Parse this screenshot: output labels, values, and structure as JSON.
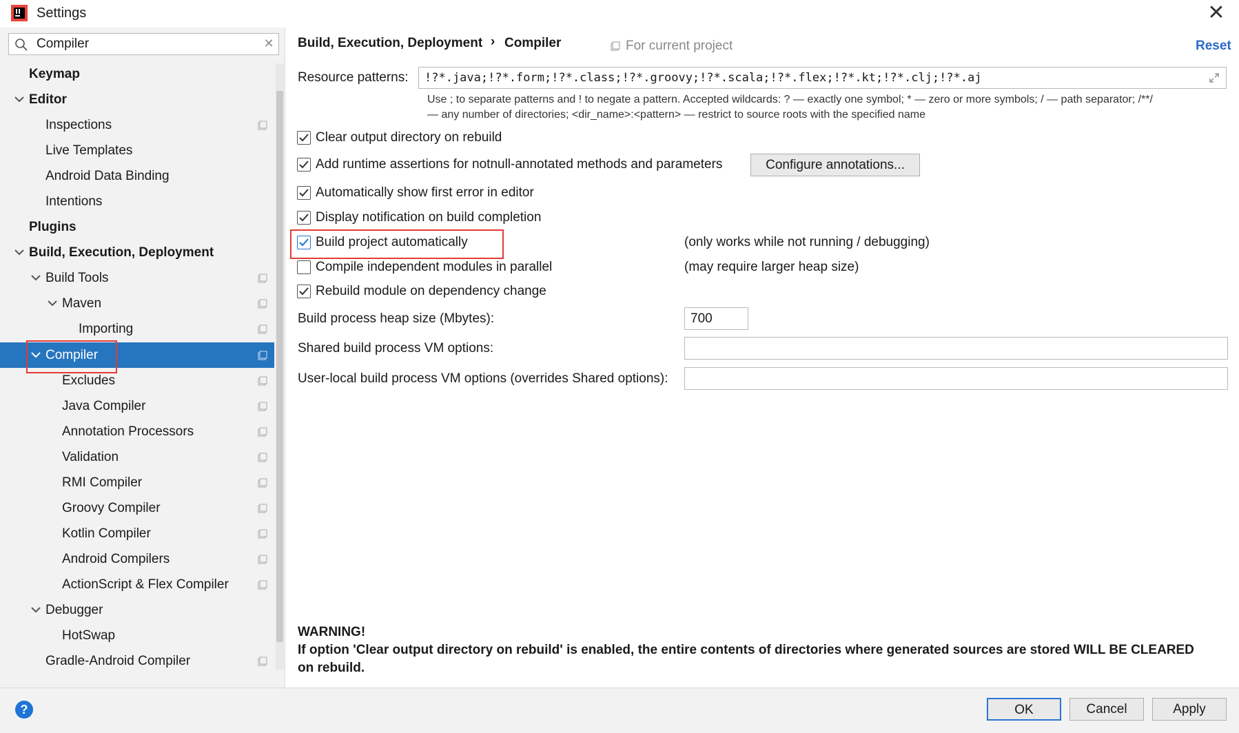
{
  "window": {
    "title": "Settings"
  },
  "search": {
    "value": "Compiler"
  },
  "tree": {
    "keymap": "Keymap",
    "editor": "Editor",
    "inspections": "Inspections",
    "live_templates": "Live Templates",
    "android_data_binding": "Android Data Binding",
    "intentions": "Intentions",
    "plugins": "Plugins",
    "build_exec_deploy": "Build, Execution, Deployment",
    "build_tools": "Build Tools",
    "maven": "Maven",
    "importing": "Importing",
    "compiler": "Compiler",
    "excludes": "Excludes",
    "java_compiler": "Java Compiler",
    "annotation_processors": "Annotation Processors",
    "validation": "Validation",
    "rmi_compiler": "RMI Compiler",
    "groovy_compiler": "Groovy Compiler",
    "kotlin_compiler": "Kotlin Compiler",
    "android_compilers": "Android Compilers",
    "actionscript_flex": "ActionScript & Flex Compiler",
    "debugger": "Debugger",
    "hotswap": "HotSwap",
    "gradle_android": "Gradle-Android Compiler"
  },
  "header": {
    "breadcrumb_parent": "Build, Execution, Deployment",
    "breadcrumb_sep": "›",
    "breadcrumb_current": "Compiler",
    "scope": "For current project",
    "reset": "Reset"
  },
  "resource": {
    "label": "Resource patterns:",
    "value": "!?*.java;!?*.form;!?*.class;!?*.groovy;!?*.scala;!?*.flex;!?*.kt;!?*.clj;!?*.aj",
    "hint_line1": "Use ; to separate patterns and ! to negate a pattern. Accepted wildcards: ? — exactly one symbol; * — zero or more symbols; / — path separator; /**/",
    "hint_line2": "— any number of directories; <dir_name>:<pattern> — restrict to source roots with the specified name"
  },
  "options": {
    "clear_output": {
      "label": "Clear output directory on rebuild",
      "checked": true
    },
    "runtime_assertions": {
      "label": "Add runtime assertions for notnull-annotated methods and parameters",
      "checked": true
    },
    "configure_annotations": "Configure annotations...",
    "show_first_error": {
      "label": "Automatically show first error in editor",
      "checked": true
    },
    "display_notification": {
      "label": "Display notification on build completion",
      "checked": true
    },
    "build_automatically": {
      "label": "Build project automatically",
      "checked": true,
      "note": "(only works while not running / debugging)"
    },
    "parallel_modules": {
      "label": "Compile independent modules in parallel",
      "checked": false,
      "note": "(may require larger heap size)"
    },
    "rebuild_on_dependency": {
      "label": "Rebuild module on dependency change",
      "checked": true
    }
  },
  "fields": {
    "heap_label": "Build process heap size (Mbytes):",
    "heap_value": "700",
    "shared_vm_label": "Shared build process VM options:",
    "shared_vm_value": "",
    "user_vm_label": "User-local build process VM options (overrides Shared options):",
    "user_vm_value": ""
  },
  "warning": {
    "title": "WARNING!",
    "text": "If option 'Clear output directory on rebuild' is enabled, the entire contents of directories where generated sources are stored WILL BE CLEARED on rebuild."
  },
  "footer": {
    "help": "?",
    "ok": "OK",
    "cancel": "Cancel",
    "apply": "Apply"
  },
  "colors": {
    "selection": "#2675bf",
    "link": "#2a6ac8",
    "highlight_box": "#e53935",
    "checkbox_tick": "#1f74d6"
  }
}
